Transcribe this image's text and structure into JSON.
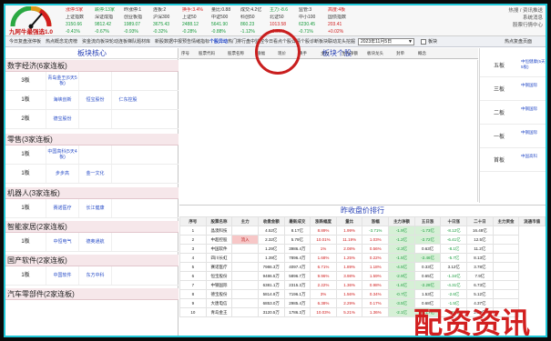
{
  "app": {
    "name": "九阿牛最强选1.0"
  },
  "header": {
    "market": [
      {
        "name": "涨停:5家",
        "cls": "up"
      },
      {
        "name": "跌停:13家",
        "cls": "down"
      },
      {
        "name": "昨涨停:1",
        "cls": ""
      },
      {
        "name": "连板:2",
        "cls": ""
      },
      {
        "name": "换手:3.4%",
        "cls": "up"
      },
      {
        "name": "量比:0.88",
        "cls": ""
      },
      {
        "name": "成交:4.2亿",
        "cls": ""
      },
      {
        "name": "主力:-8.6",
        "cls": "down"
      },
      {
        "name": "监管:3",
        "cls": ""
      },
      {
        "name": "高度:4板",
        "cls": "up"
      },
      {
        "name": "上证指数",
        "cls": ""
      },
      {
        "name": "深证成指",
        "cls": ""
      },
      {
        "name": "创业板指",
        "cls": ""
      },
      {
        "name": "沪深300",
        "cls": ""
      },
      {
        "name": "上证50",
        "cls": ""
      },
      {
        "name": "中证500",
        "cls": ""
      },
      {
        "name": "科创50",
        "cls": ""
      },
      {
        "name": "北证50",
        "cls": ""
      },
      {
        "name": "中小100",
        "cls": ""
      },
      {
        "name": "国债指数",
        "cls": ""
      },
      {
        "name": "3150.66",
        "cls": "down"
      },
      {
        "name": "9812.42",
        "cls": "down"
      },
      {
        "name": "1989.07",
        "cls": "down"
      },
      {
        "name": "3675.43",
        "cls": "down"
      },
      {
        "name": "2488.12",
        "cls": "down"
      },
      {
        "name": "5641.90",
        "cls": "down"
      },
      {
        "name": "860.23",
        "cls": "down"
      },
      {
        "name": "1013.58",
        "cls": "up"
      },
      {
        "name": "6230.45",
        "cls": "down"
      },
      {
        "name": "203.41",
        "cls": "up"
      },
      {
        "name": "-0.41%",
        "cls": "down"
      },
      {
        "name": "-0.67%",
        "cls": "down"
      },
      {
        "name": "-0.93%",
        "cls": "down"
      },
      {
        "name": "-0.32%",
        "cls": "down"
      },
      {
        "name": "-0.28%",
        "cls": "down"
      },
      {
        "name": "-0.88%",
        "cls": "down"
      },
      {
        "name": "-1.12%",
        "cls": "down"
      },
      {
        "name": "+0.36%",
        "cls": "up"
      },
      {
        "name": "-0.71%",
        "cls": "down"
      },
      {
        "name": "+0.02%",
        "cls": "up"
      }
    ],
    "right_lines": [
      "热搜 / 资讯推送",
      "系统消息",
      "股票行情中心"
    ]
  },
  "tabs": [
    "今日复盘",
    "涨停板",
    "热点概念",
    "龙虎榜",
    "资金流向",
    "板块轮动",
    "连板梯队",
    "题材库",
    "新股数据",
    "中报预告",
    "情绪指标",
    "个股异动",
    "热门排行",
    "盘中监控",
    "今日看点",
    "个股详情",
    "个股诊断",
    "板块联动",
    "龙头挖掘"
  ],
  "active_tab": 11,
  "toolbar": {
    "date_value": "2023年11月5日",
    "checkbox_label": "板块",
    "right_link": "热点复盘页面"
  },
  "left_panel": {
    "title": "板块核心",
    "groups": [
      {
        "title": "数字经济(6家连板)",
        "rows": [
          {
            "label": "3板",
            "stocks": [
              "青岛金王(6天5板)",
              "",
              ""
            ]
          },
          {
            "label": "1板",
            "stocks": [
              "海峡创新",
              "恒宝股份",
              "仁东控股"
            ]
          },
          {
            "label": "2板",
            "stocks": [
              "德宝股份",
              "",
              ""
            ]
          }
        ]
      },
      {
        "title": "零售(3家连板)",
        "rows": [
          {
            "label": "1板",
            "stocks": [
              "中国高科(5天4板)",
              "",
              ""
            ]
          },
          {
            "label": "1板",
            "stocks": [
              "步步高",
              "金一文化",
              ""
            ]
          }
        ]
      },
      {
        "title": "机器人(3家连板)",
        "rows": [
          {
            "label": "1板",
            "stocks": [
              "赛诺医疗",
              "长江健康",
              ""
            ]
          }
        ]
      },
      {
        "title": "智能家居(2家连板)",
        "rows": [
          {
            "label": "1板",
            "stocks": [
              "中恒电气",
              "德奥通航",
              ""
            ]
          }
        ]
      },
      {
        "title": "国产软件(2家连板)",
        "rows": [
          {
            "label": "1板",
            "stocks": [
              "中国软件",
              "东方中科",
              ""
            ]
          }
        ]
      },
      {
        "title": "汽车零部件(2家连板)",
        "rows": []
      }
    ]
  },
  "center": {
    "title": "板块个股",
    "columns": [
      "序号",
      "股票代码",
      "股票名称",
      "涨幅",
      "现价",
      "换手",
      "主力",
      "主力净额",
      "板块龙头",
      "封单",
      "概念"
    ]
  },
  "right_panel": {
    "rows": [
      {
        "label": "五板",
        "link": "中恒健康(5天5板)"
      },
      {
        "label": "三板",
        "link": "中钢国际"
      },
      {
        "label": "二板",
        "link": "中钢国际"
      },
      {
        "label": "一板",
        "link": "中钢国际"
      },
      {
        "label": "首板",
        "link": "中国高科"
      }
    ]
  },
  "table": {
    "title": "昨收盘价排行",
    "columns": [
      "序号",
      "股票名称",
      "主力",
      "收盘金额",
      "最新成交",
      "涨跌幅度",
      "量比",
      "涨幅",
      "主力净额",
      "五日涨",
      "十日涨",
      "二十日",
      "主力资金",
      "流通市值"
    ],
    "rows": [
      [
        "1",
        "晶澳科技",
        "",
        "4.52亿",
        "8.17亿",
        "8.89%",
        "1.99%",
        "-3.71%",
        "-1.9亿",
        "-1.73亿",
        "-8.12亿",
        "16.48亿",
        ""
      ],
      [
        "2",
        "中超控股",
        "流入",
        "2.32亿",
        "5.79亿",
        "10.01%",
        "11.19%",
        "1.03%",
        "-1.2亿",
        "-2.72亿",
        "-6.41亿",
        "12.5亿",
        ""
      ],
      [
        "3",
        "中国软件",
        "",
        "1.29亿",
        "3986.4万",
        "1%",
        "2.08%",
        "0.56%",
        "-2.3亿",
        "0.63亿",
        "-8.1亿",
        "11.2亿",
        ""
      ],
      [
        "4",
        "四川长虹",
        "",
        "1.39亿",
        "7896.4万",
        "1.68%",
        "1.25%",
        "0.22%",
        "-1.5亿",
        "-2.46亿",
        "-5.7亿",
        "8.13亿",
        ""
      ],
      [
        "5",
        "赛诺医疗",
        "",
        "7986.3万",
        "4097.4万",
        "6.71%",
        "1.89%",
        "1.18%",
        "-4.5亿",
        "0.33亿",
        "3.12亿",
        "3.78亿",
        ""
      ],
      [
        "6",
        "恒宝股份",
        "",
        "9486.5万",
        "5896.7万",
        "9.96%",
        "3.98%",
        "1.59%",
        "-2.9亿",
        "0.65亿",
        "-1.34亿",
        "7.9亿",
        ""
      ],
      [
        "7",
        "中钢国际",
        "",
        "6381.1万",
        "2315.3万",
        "2.22%",
        "1.36%",
        "0.98%",
        "-1.6亿",
        "-2.28亿",
        "-4.31亿",
        "6.73亿",
        ""
      ],
      [
        "8",
        "德宝股份",
        "",
        "5814.9万",
        "7196.1万",
        "3%",
        "1.56%",
        "0.34%",
        "-0.7亿",
        "1.53亿",
        "-2.6亿",
        "5.12亿",
        ""
      ],
      [
        "9",
        "大唐电信",
        "",
        "6853.0万",
        "2985.4万",
        "6.38%",
        "2.29%",
        "0.17%",
        "-3.5亿",
        "0.68亿",
        "-1.5亿",
        "4.37亿",
        ""
      ],
      [
        "10",
        "青岛金王",
        "",
        "3120.5万",
        "1786.3万",
        "10.03%",
        "5.21%",
        "1.36%",
        "-2.1亿",
        "-1.17亿",
        "-2.04亿",
        "2.89亿",
        ""
      ]
    ]
  },
  "watermark": "配资资讯"
}
